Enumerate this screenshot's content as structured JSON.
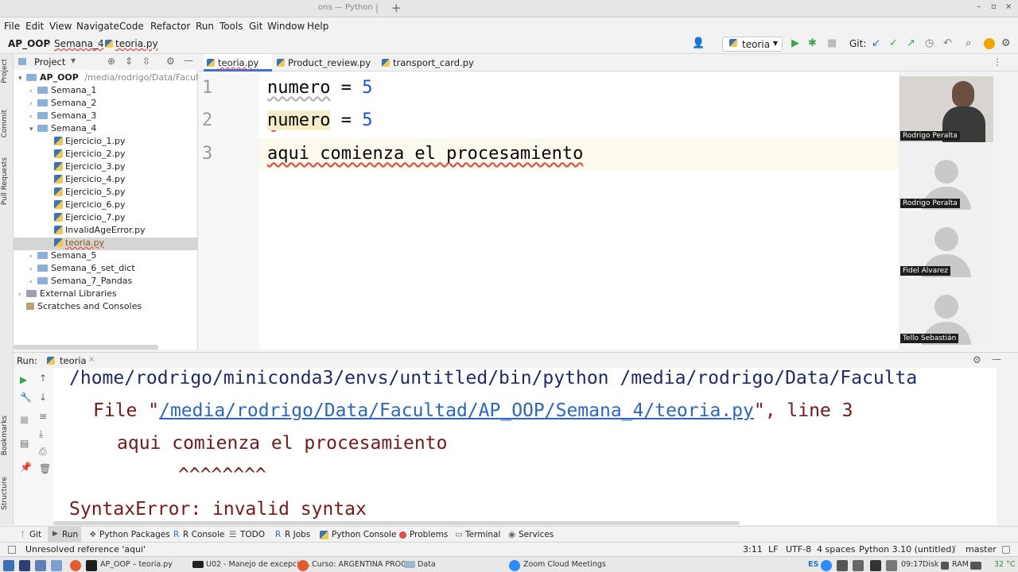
{
  "window": {
    "title_fragment": "ons — Python",
    "tab_plus": "+",
    "controls": [
      "–",
      "▫",
      "×"
    ]
  },
  "menu": [
    "File",
    "Edit",
    "View",
    "Navigate",
    "Code",
    "Refactor",
    "Run",
    "Tools",
    "Git",
    "Window",
    "Help"
  ],
  "breadcrumb": {
    "project": "AP_OOP",
    "folder": "Semana_4",
    "file": "teoria.py"
  },
  "toolbar": {
    "run_config": "teoria",
    "git_label": "Git:"
  },
  "left_strip": [
    "Project",
    "Commit",
    "Pull Requests",
    "Bookmarks",
    "Structure"
  ],
  "project_panel": {
    "title": "Project",
    "root": {
      "name": "AP_OOP",
      "path": "/media/rodrigo/Data/Facult"
    },
    "items": [
      {
        "label": "Semana_1",
        "type": "folder",
        "depth": 1,
        "expanded": false
      },
      {
        "label": "Semana_2",
        "type": "folder",
        "depth": 1,
        "expanded": false
      },
      {
        "label": "Semana_3",
        "type": "folder",
        "depth": 1,
        "expanded": false
      },
      {
        "label": "Semana_4",
        "type": "folder",
        "depth": 1,
        "expanded": true
      },
      {
        "label": "Ejercicio_1.py",
        "type": "py",
        "depth": 2
      },
      {
        "label": "Ejercicio_2.py",
        "type": "py",
        "depth": 2
      },
      {
        "label": "Ejercicio_3.py",
        "type": "py",
        "depth": 2
      },
      {
        "label": "Ejercicio_4.py",
        "type": "py",
        "depth": 2
      },
      {
        "label": "Ejercicio_5.py",
        "type": "py",
        "depth": 2
      },
      {
        "label": "Ejercicio_6.py",
        "type": "py",
        "depth": 2
      },
      {
        "label": "Ejercicio_7.py",
        "type": "py",
        "depth": 2
      },
      {
        "label": "InvalidAgeError.py",
        "type": "py",
        "depth": 2
      },
      {
        "label": "teoria.py",
        "type": "py",
        "depth": 2,
        "selected": true
      },
      {
        "label": "Semana_5",
        "type": "folder",
        "depth": 1,
        "expanded": false
      },
      {
        "label": "Semana_6_set_dict",
        "type": "folder",
        "depth": 1,
        "expanded": false
      },
      {
        "label": "Semana_7_Pandas",
        "type": "folder",
        "depth": 1,
        "expanded": false
      },
      {
        "label": "External Libraries",
        "type": "lib",
        "depth": 0
      },
      {
        "label": "Scratches and Consoles",
        "type": "scratch",
        "depth": 0
      }
    ]
  },
  "editor": {
    "tabs": [
      "teoria.py",
      "Product_review.py",
      "transport_card.py"
    ],
    "active_tab": "teoria.py",
    "line_numbers": [
      "1",
      "2",
      "3"
    ],
    "lines": {
      "l1_name": "numero",
      "l1_op": " = ",
      "l1_val": "5",
      "l2_name": "numero",
      "l2_op": " = ",
      "l2_val": "5",
      "l3": "aqui comienza el procesamiento"
    }
  },
  "video_tiles": [
    "Rodrigo Peralta",
    "Rodrigo Peralta",
    "Fidel Alvarez",
    "Tello Sebastián"
  ],
  "run_panel": {
    "label": "Run:",
    "tab": "teoria",
    "output": {
      "cmd": "/home/rodrigo/miniconda3/envs/untitled/bin/python /media/rodrigo/Data/Faculta",
      "file_prefix": "File \"",
      "file_link": "/media/rodrigo/Data/Facultad/AP_OOP/Semana_4/teoria.py",
      "file_suffix": "\", line 3",
      "code": "aqui comienza el procesamiento",
      "caret": "^^^^^^^^",
      "error": "SyntaxError: invalid syntax"
    }
  },
  "bottom_tools": [
    "Git",
    "Run",
    "Python Packages",
    "R Console",
    "TODO",
    "R Jobs",
    "Python Console",
    "Problems",
    "Terminal",
    "Services"
  ],
  "status": {
    "message": "Unresolved reference 'aqui'",
    "position": "3:11",
    "line_sep": "LF",
    "encoding": "UTF-8",
    "indent": "4 spaces",
    "interpreter": "Python 3.10 (untitled)",
    "branch": "master"
  },
  "taskbar": {
    "items": [
      "AP_OOP – teoria.py",
      "U02 - Manejo de excepcio...",
      "Curso: ARGENTINA PROG...",
      "Data",
      "Zoom Cloud Meetings"
    ],
    "tray": {
      "lang": "ES",
      "clock": "09:17",
      "disk": "Disk",
      "ram": "RAM",
      "pct": "32 °C"
    }
  }
}
